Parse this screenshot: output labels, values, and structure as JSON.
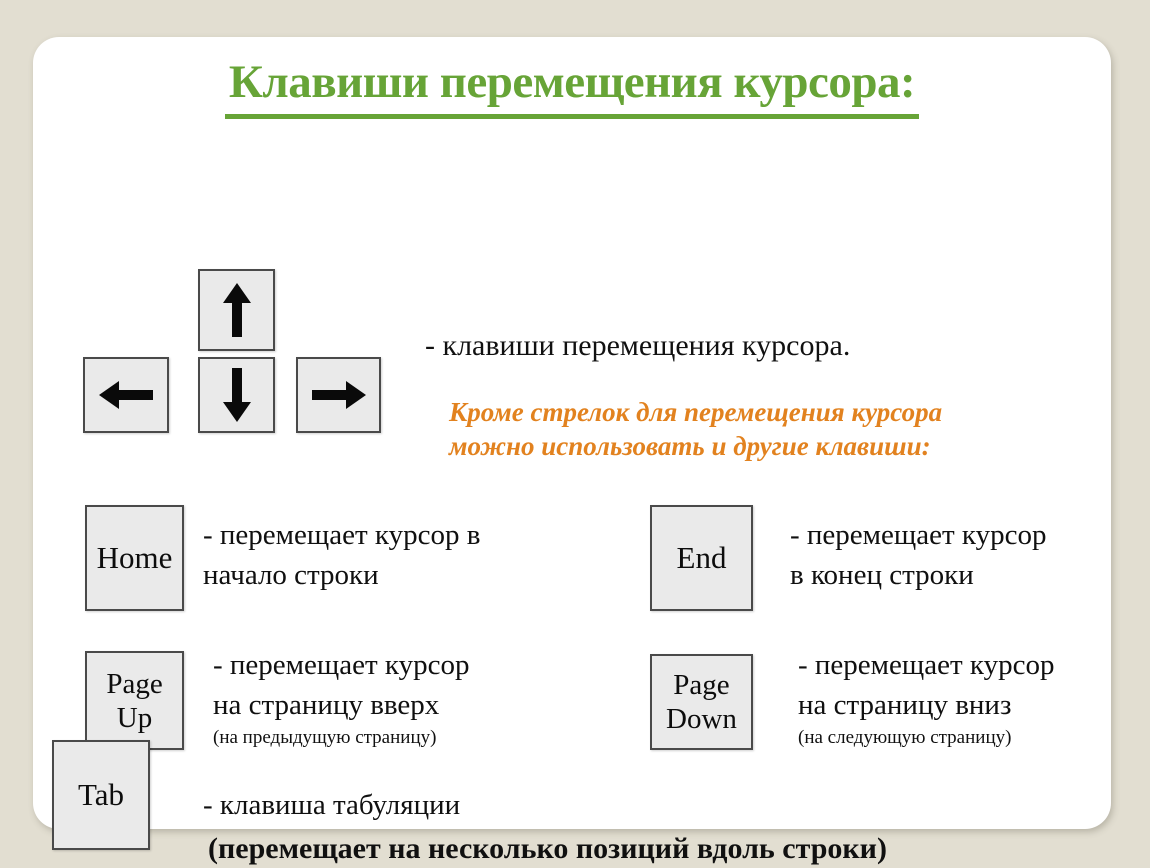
{
  "slide": {
    "title": "Клавиши перемещения курсора:",
    "title_color": "#67a437",
    "background_color": "#e2ded1",
    "card_color": "#ffffff"
  },
  "arrow_cluster": {
    "keys": [
      {
        "name": "arrow-up",
        "glyph": "up-arrow-icon"
      },
      {
        "name": "arrow-left",
        "glyph": "left-arrow-icon"
      },
      {
        "name": "arrow-down",
        "glyph": "down-arrow-icon"
      },
      {
        "name": "arrow-right",
        "glyph": "right-arrow-icon"
      }
    ],
    "description": "- клавиши перемещения курсора.",
    "note_line1": "Кроме стрелок для перемещения курсора",
    "note_line2": "можно использовать и другие клавиши:",
    "note_color": "#e2821f"
  },
  "key_rows": [
    {
      "key_label": "Home",
      "key_label_line2": "",
      "description_line1": "- перемещает курсор в",
      "description_line2": "начало строки",
      "sub_note": ""
    },
    {
      "key_label": "End",
      "key_label_line2": "",
      "description_line1": "- перемещает курсор",
      "description_line2": "в конец строки",
      "sub_note": ""
    },
    {
      "key_label": "Page",
      "key_label_line2": "Up",
      "description_line1": "- перемещает курсор",
      "description_line2": "на страницу вверх",
      "sub_note": "(на предыдущую страницу)"
    },
    {
      "key_label": "Page",
      "key_label_line2": "Down",
      "description_line1": "- перемещает курсор",
      "description_line2": "на страницу вниз",
      "sub_note": "(на следующую страницу)"
    },
    {
      "key_label": "Tab",
      "key_label_line2": "",
      "description_line1": "- клавиша табуляции",
      "description_line2": "",
      "sub_note": ""
    }
  ],
  "tab_note": "(перемещает на несколько позиций вдоль строки)"
}
